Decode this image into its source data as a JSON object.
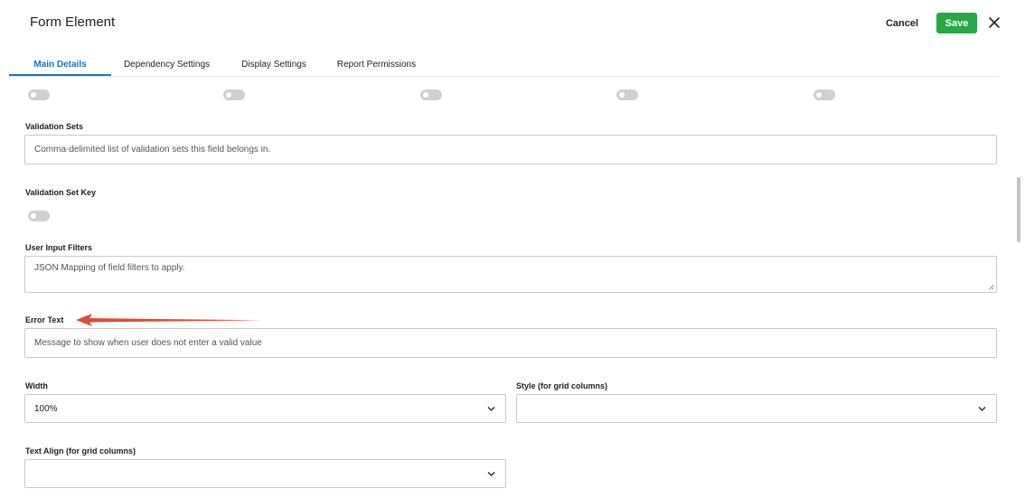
{
  "header": {
    "title": "Form Element",
    "cancel_label": "Cancel",
    "save_label": "Save",
    "close_icon": "close-icon"
  },
  "tabs": [
    {
      "label": "Main Details",
      "active": true
    },
    {
      "label": "Dependency Settings",
      "active": false
    },
    {
      "label": "Display Settings",
      "active": false
    },
    {
      "label": "Report Permissions",
      "active": false
    }
  ],
  "colors": {
    "accent": "#1a73c8",
    "save_button": "#27a844",
    "annotation_arrow": "#e04a3a",
    "toggle_off": "#cfcfd4"
  },
  "top_toggles": [
    {
      "state": "off"
    },
    {
      "state": "off"
    },
    {
      "state": "off"
    },
    {
      "state": "off"
    },
    {
      "state": "off"
    }
  ],
  "fields": {
    "validation_sets": {
      "label": "Validation Sets",
      "placeholder": "Comma-delimited list of validation sets this field belongs in."
    },
    "validation_set_key": {
      "label": "Validation Set Key",
      "state": "off"
    },
    "user_input_filters": {
      "label": "User Input Filters",
      "placeholder": "JSON Mapping of field filters to apply."
    },
    "error_text": {
      "label": "Error Text",
      "placeholder": "Message to show when user does not enter a valid value"
    },
    "width": {
      "label": "Width",
      "value": "100%"
    },
    "style": {
      "label": "Style (for grid columns)",
      "value": ""
    },
    "text_align": {
      "label": "Text Align (for grid columns)",
      "value": ""
    }
  },
  "annotation": {
    "type": "arrow",
    "points_to": "Error Text",
    "icon": "red-arrow-icon"
  }
}
